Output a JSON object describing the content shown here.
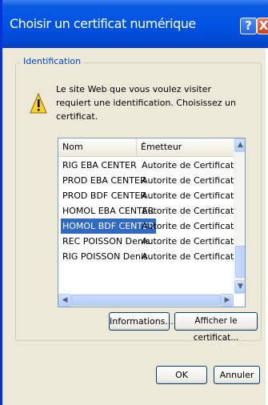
{
  "window": {
    "title": "Choisir un certificat numérique"
  },
  "group": {
    "label": "Identification",
    "message": "Le site Web que vous voulez visiter requiert une identification. Choisissez un certificat."
  },
  "list": {
    "columns": [
      "Nom",
      "Émetteur"
    ],
    "rows": [
      {
        "name": "RIG EBA CENTER",
        "issuer": "Autorite de Certification - Au..."
      },
      {
        "name": "PROD EBA CENTER",
        "issuer": "Autorite de Certification - Au..."
      },
      {
        "name": "PROD BDF CENTER",
        "issuer": "Autorite de Certification - Au..."
      },
      {
        "name": "HOMOL EBA CENTER",
        "issuer": "Autorite de Certification - Au..."
      },
      {
        "name": "HOMOL BDF CENTER",
        "issuer": "Autorite de Certification - Au..."
      },
      {
        "name": "REC POISSON Denis",
        "issuer": "Autorite de Certification - Au..."
      },
      {
        "name": "RIG POISSON Denis",
        "issuer": "Autorite de Certification - Au..."
      }
    ],
    "selected_index": 4
  },
  "buttons": {
    "info": "Informations...",
    "show_cert": "Afficher le certificat...",
    "ok": "OK",
    "cancel": "Annuler"
  },
  "icons": {
    "help": "?",
    "close": "X"
  },
  "colors": {
    "titlebar": "#0054e3",
    "selection": "#316ac5",
    "group_label": "#0046d5"
  }
}
